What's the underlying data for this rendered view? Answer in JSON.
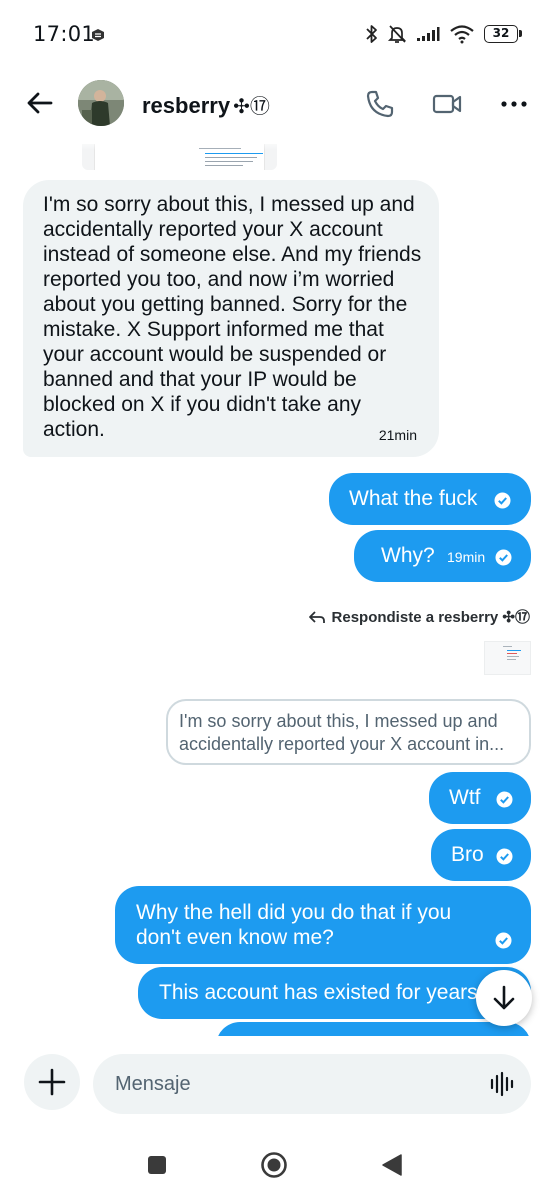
{
  "status_bar": {
    "time": "17:01",
    "battery": "32"
  },
  "header": {
    "contact_name": "resberry",
    "contact_badge": "✣⑰"
  },
  "messages": [
    {
      "direction": "in",
      "text": "I'm so sorry about this,  I messed up and accidentally reported your X account instead of someone else. And my friends reported you too, and now i’m worried about you getting banned. Sorry for the mistake. X Support informed me that your account would be suspended or banned and that your IP would be blocked on X if you didn't take any action.",
      "time": "21min"
    },
    {
      "direction": "out",
      "text": "What the fuck"
    },
    {
      "direction": "out",
      "text": "Why?",
      "time": "19min"
    },
    {
      "direction": "out",
      "text": "Wtf"
    },
    {
      "direction": "out",
      "text": "Bro"
    },
    {
      "direction": "out",
      "text": "Why the hell did you do that if you don't even know me?"
    },
    {
      "direction": "out",
      "text": "This account has existed for years"
    }
  ],
  "reply_context": {
    "label": "Respondiste a resberry ✣⑰",
    "quote": "I'm so sorry about this,  I messed up and accidentally reported your X account in..."
  },
  "composer": {
    "placeholder": "Mensaje"
  },
  "icons": {
    "back": "arrow-left-icon",
    "call": "phone-icon",
    "video": "video-camera-icon",
    "more": "more-dots-icon",
    "add": "plus-icon",
    "voice": "voice-waveform-icon",
    "scroll": "arrow-down-icon",
    "read": "check-circle-icon"
  },
  "colors": {
    "accent": "#1d9bf0",
    "incoming_bubble": "#eff3f4",
    "text": "#0f1419",
    "muted": "#536471"
  }
}
